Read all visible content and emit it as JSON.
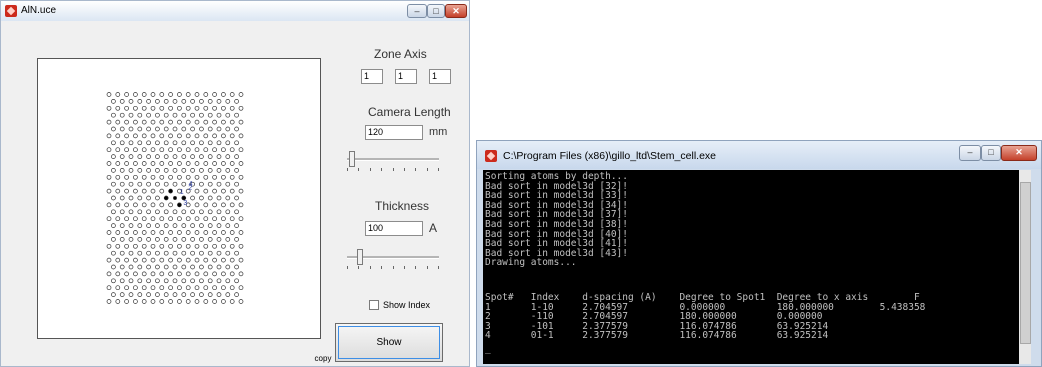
{
  "app_window": {
    "title": "AlN.uce",
    "zone_axis": {
      "label": "Zone Axis",
      "values": [
        "1",
        "1",
        "1"
      ]
    },
    "camera_length": {
      "label": "Camera Length",
      "value": "120",
      "unit": "mm"
    },
    "thickness": {
      "label": "Thickness",
      "value": "100",
      "unit": "A"
    },
    "show_index": {
      "label": "Show Index",
      "checked": false
    },
    "show_button": "Show",
    "copy_button": "copy",
    "spot_labels": [
      "1",
      "2",
      "3",
      "4"
    ]
  },
  "console_window": {
    "title": "C:\\Program Files (x86)\\gillo_ltd\\Stem_cell.exe",
    "log_lines": [
      "Sorting atoms by depth...",
      "Bad sort in model3d [32]!",
      "Bad sort in model3d [33]!",
      "Bad sort in model3d [34]!",
      "Bad sort in model3d [37]!",
      "Bad sort in model3d [38]!",
      "Bad sort in model3d [40]!",
      "Bad sort in model3d [41]!",
      "Bad sort in model3d [43]!",
      "Drawing atoms..."
    ],
    "table_header": "Spot#   Index    d-spacing (A)    Degree to Spot1  Degree to x axis        F",
    "table_rows": [
      "1       1-10     2.704597         0.000000         180.000000        5.438358",
      "2       -110     2.704597         180.000000       0.000000",
      "3       -101     2.377579         116.074786       63.925214",
      "4       01-1     2.377579         116.074786       63.925214"
    ]
  },
  "colors": {
    "title_icon": "#cc2a1c",
    "console_bg": "#000000",
    "console_text": "#c0c0c0"
  }
}
